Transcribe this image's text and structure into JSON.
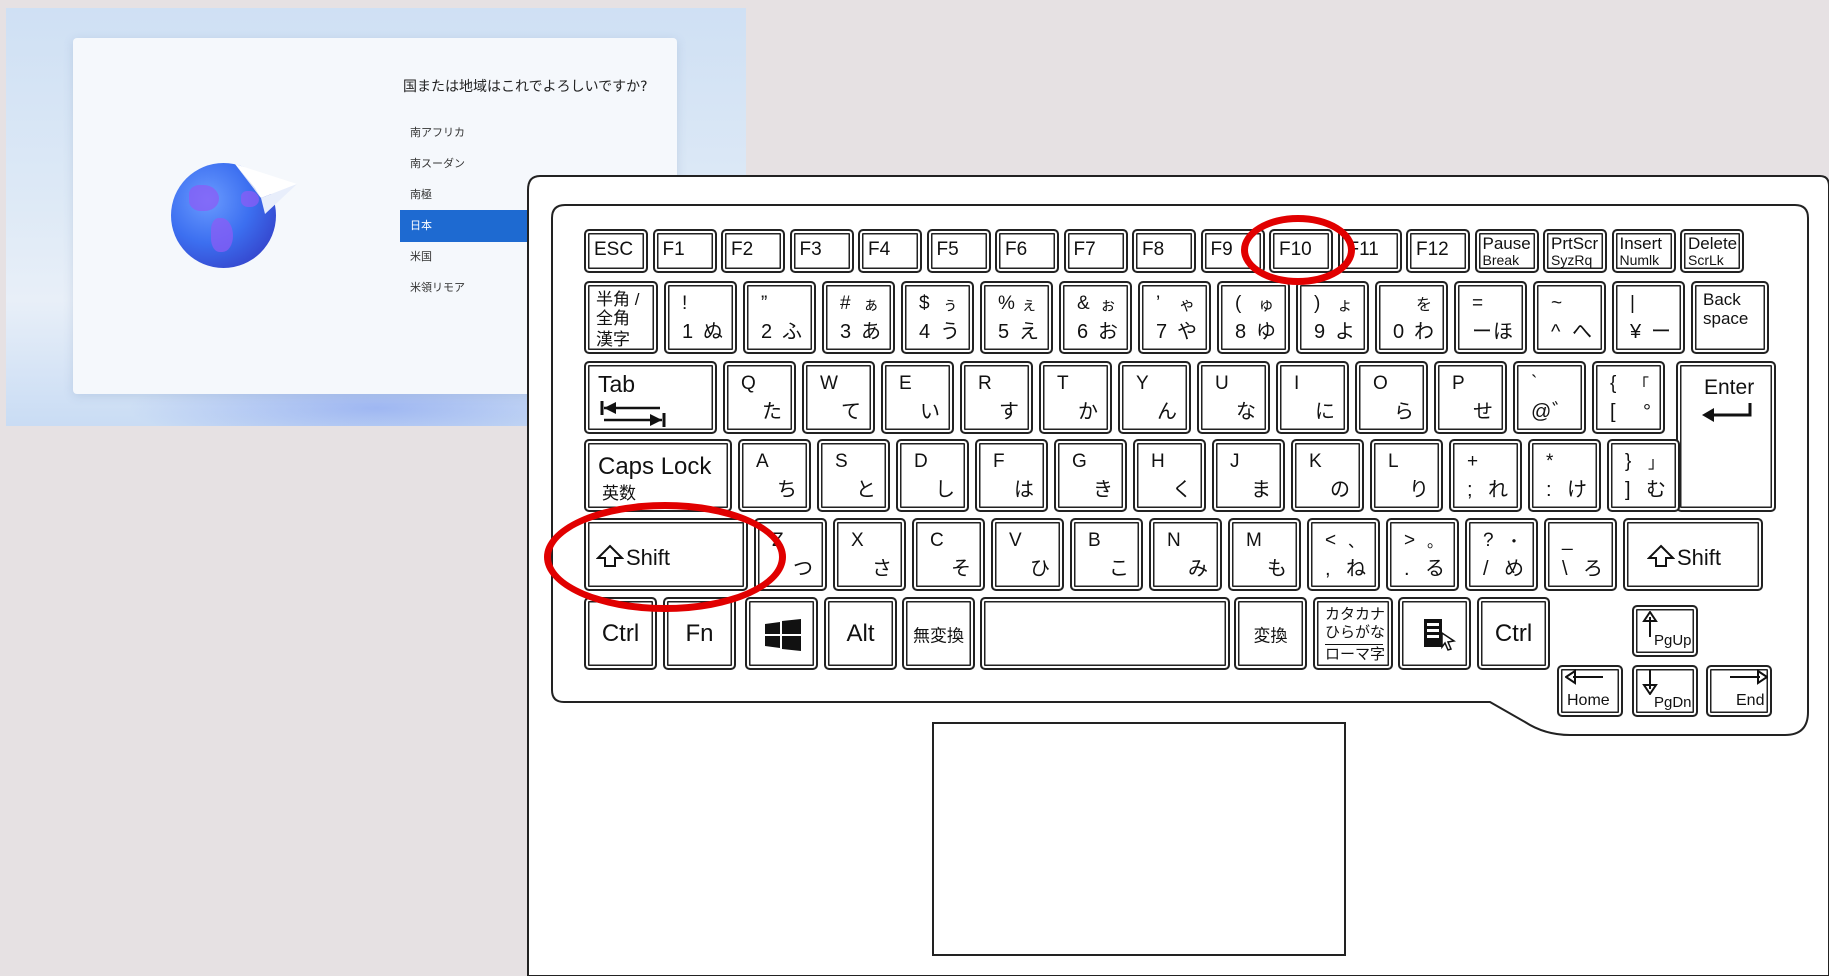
{
  "setup_screen": {
    "question": "国または地域はこれでよろしいですか?",
    "countries": [
      "南アフリカ",
      "南スーダン",
      "南極",
      "日本",
      "米国",
      "米領リモア"
    ],
    "selected": "日本",
    "accent_color": "#1e6ad1"
  },
  "keyboard": {
    "function_row": [
      {
        "main": "ESC"
      },
      {
        "main": "F1"
      },
      {
        "main": "F2"
      },
      {
        "main": "F3"
      },
      {
        "main": "F4"
      },
      {
        "main": "F5"
      },
      {
        "main": "F6"
      },
      {
        "main": "F7"
      },
      {
        "main": "F8"
      },
      {
        "main": "F9"
      },
      {
        "main": "F10"
      },
      {
        "main": "F11"
      },
      {
        "main": "F12"
      },
      {
        "main": "Pause",
        "sub": "Break"
      },
      {
        "main": "PrtScr",
        "sub": "SyzRq"
      },
      {
        "main": "Insert",
        "sub": "Numlk"
      },
      {
        "main": "Delete",
        "sub": "ScrLk"
      }
    ],
    "number_row": [
      {
        "l1": "半角 /",
        "l2": "全角",
        "l3": "漢字"
      },
      {
        "tl": "!",
        "tr": "",
        "bl": "1",
        "br": "ぬ"
      },
      {
        "tl": "”",
        "tr": "",
        "bl": "2",
        "br": "ふ"
      },
      {
        "tl": "#",
        "tr": "ぁ",
        "bl": "3",
        "br": "あ"
      },
      {
        "tl": "$",
        "tr": "ぅ",
        "bl": "4",
        "br": "う"
      },
      {
        "tl": "%",
        "tr": "ぇ",
        "bl": "5",
        "br": "え"
      },
      {
        "tl": "&",
        "tr": "ぉ",
        "bl": "6",
        "br": "お"
      },
      {
        "tl": "’",
        "tr": "ゃ",
        "bl": "7",
        "br": "や"
      },
      {
        "tl": "(",
        "tr": "ゅ",
        "bl": "8",
        "br": "ゆ"
      },
      {
        "tl": ")",
        "tr": "ょ",
        "bl": "9",
        "br": "よ"
      },
      {
        "tl": "",
        "tr": "を",
        "bl": "0",
        "br": "わ"
      },
      {
        "tl": "=",
        "tr": "",
        "bl": "ー",
        "br": "ほ"
      },
      {
        "tl": "~",
        "tr": "",
        "bl": "^",
        "br": "へ"
      },
      {
        "tl": "|",
        "tr": "",
        "bl": "¥",
        "br": "ー"
      },
      {
        "l1": "Back",
        "l2": "space"
      }
    ],
    "q_row": [
      {
        "main": "Tab"
      },
      {
        "tl": "Q",
        "br": "た"
      },
      {
        "tl": "W",
        "br": "て"
      },
      {
        "tl": "E",
        "br": "い"
      },
      {
        "tl": "R",
        "br": "す"
      },
      {
        "tl": "T",
        "br": "か"
      },
      {
        "tl": "Y",
        "br": "ん"
      },
      {
        "tl": "U",
        "br": "な"
      },
      {
        "tl": "I",
        "br": "に"
      },
      {
        "tl": "O",
        "br": "ら"
      },
      {
        "tl": "P",
        "br": "せ"
      },
      {
        "tl": "`",
        "bl": "@",
        "br": "゛"
      },
      {
        "tl": "{",
        "tr": "「",
        "bl": "[",
        "br": "°"
      },
      {
        "main": "Enter"
      }
    ],
    "a_row": [
      {
        "main": "Caps Lock",
        "sub": "英数"
      },
      {
        "tl": "A",
        "br": "ち"
      },
      {
        "tl": "S",
        "br": "と"
      },
      {
        "tl": "D",
        "br": "し"
      },
      {
        "tl": "F",
        "br": "は"
      },
      {
        "tl": "G",
        "br": "き"
      },
      {
        "tl": "H",
        "br": "く"
      },
      {
        "tl": "J",
        "br": "ま"
      },
      {
        "tl": "K",
        "br": "の"
      },
      {
        "tl": "L",
        "br": "り"
      },
      {
        "tl": "+",
        "bl": ";",
        "br": "れ"
      },
      {
        "tl": "*",
        "bl": ":",
        "br": "け"
      },
      {
        "tl": "}",
        "tr": "」",
        "bl": "]",
        "br": "む"
      }
    ],
    "z_row": [
      {
        "main": "Shift"
      },
      {
        "tl": "Z",
        "br": "つ"
      },
      {
        "tl": "X",
        "br": "さ"
      },
      {
        "tl": "C",
        "br": "そ"
      },
      {
        "tl": "V",
        "br": "ひ"
      },
      {
        "tl": "B",
        "br": "こ"
      },
      {
        "tl": "N",
        "br": "み"
      },
      {
        "tl": "M",
        "br": "も"
      },
      {
        "tl": "<",
        "tr": "、",
        "bl": ",",
        "br": "ね"
      },
      {
        "tl": ">",
        "tr": "。",
        "bl": ".",
        "br": "る"
      },
      {
        "tl": "?",
        "tr": "・",
        "bl": "/",
        "br": "め"
      },
      {
        "tl": "_",
        "bl": "\\",
        "br": "ろ"
      },
      {
        "main": "Shift"
      }
    ],
    "bottom_row": {
      "ctrl_left": "Ctrl",
      "fn": "Fn",
      "alt": "Alt",
      "muhenkan": "無変換",
      "henkan": "変換",
      "kana_1": "カタカナ",
      "kana_2": "ひらがな",
      "kana_3": "ローマ字",
      "ctrl_right": "Ctrl",
      "pgup": "PgUp",
      "pgdn": "PgDn",
      "home": "Home",
      "end": "End"
    },
    "highlighted_keys": [
      "F10",
      "Shift"
    ],
    "highlight_color": "#e10000"
  }
}
